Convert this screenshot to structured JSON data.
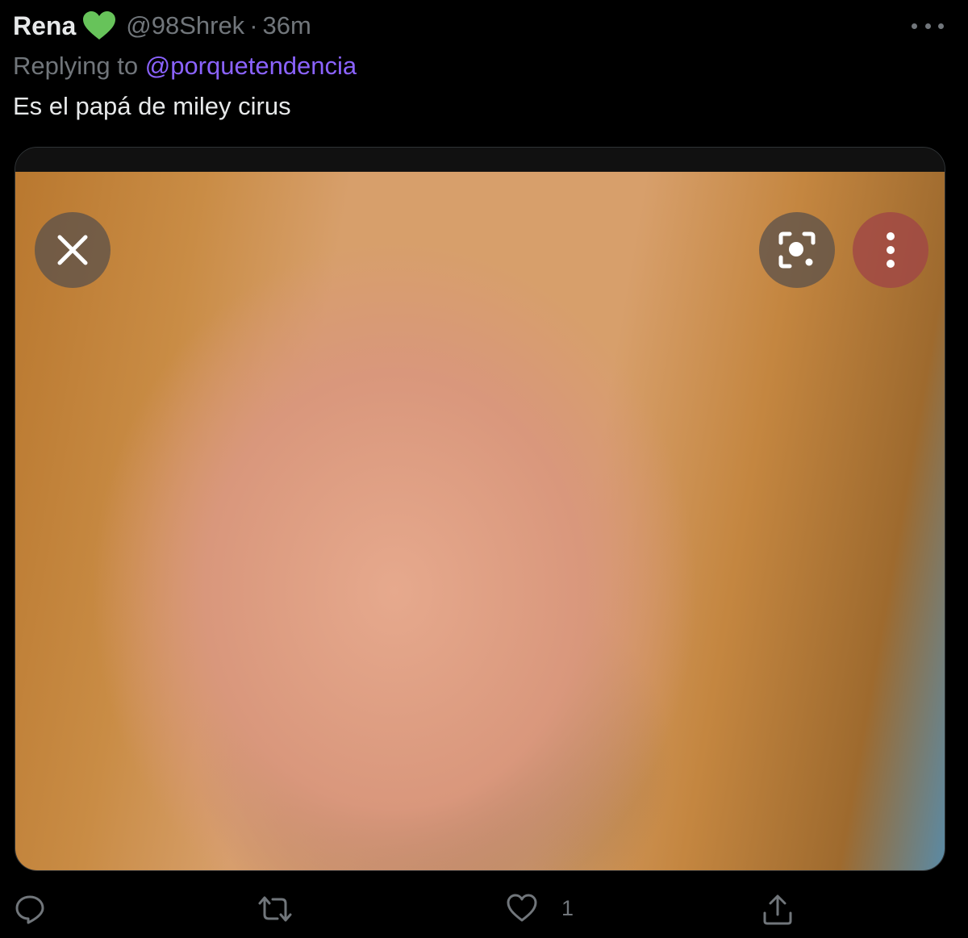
{
  "tweet": {
    "author_name": "Rena",
    "handle": "@98Shrek",
    "separator": "·",
    "time": "36m",
    "replying_prefix": "Replying to",
    "replying_to": "@porquetendencia",
    "text": "Es el papá de miley cirus",
    "like_count": "1"
  },
  "icons": {
    "author_badge": "green-heart-icon",
    "more": "more-horizontal-icon",
    "media_close": "close-icon",
    "media_lens": "lens-icon",
    "media_menu": "more-vertical-icon",
    "reply": "reply-icon",
    "retweet": "retweet-icon",
    "like": "heart-icon",
    "share": "share-icon"
  },
  "colors": {
    "background": "#000000",
    "text_primary": "#e7e9ea",
    "text_secondary": "#71767b",
    "mention": "#8b63ff",
    "badge_green": "#67c35a"
  }
}
